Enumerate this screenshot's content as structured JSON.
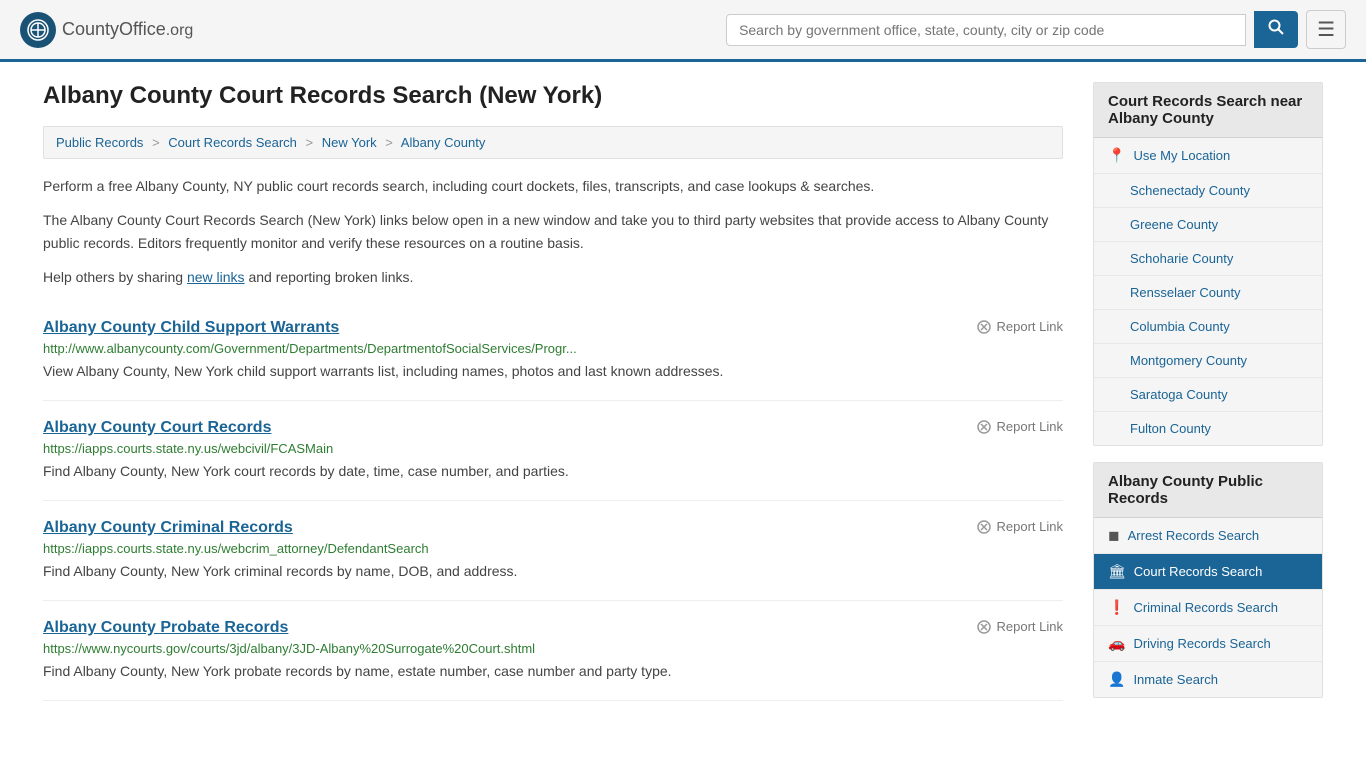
{
  "header": {
    "logo_text": "CountyOffice",
    "logo_suffix": ".org",
    "search_placeholder": "Search by government office, state, county, city or zip code"
  },
  "page": {
    "title": "Albany County Court Records Search (New York)",
    "breadcrumb": [
      {
        "label": "Public Records",
        "href": "#"
      },
      {
        "label": "Court Records Search",
        "href": "#"
      },
      {
        "label": "New York",
        "href": "#"
      },
      {
        "label": "Albany County",
        "href": "#"
      }
    ],
    "desc1": "Perform a free Albany County, NY public court records search, including court dockets, files, transcripts, and case lookups & searches.",
    "desc2": "The Albany County Court Records Search (New York) links below open in a new window and take you to third party websites that provide access to Albany County public records. Editors frequently monitor and verify these resources on a routine basis.",
    "desc3_pre": "Help others by sharing ",
    "desc3_link": "new links",
    "desc3_post": " and reporting broken links."
  },
  "results": [
    {
      "title": "Albany County Child Support Warrants",
      "url": "http://www.albanycounty.com/Government/Departments/DepartmentofSocialServices/Progr...",
      "desc": "View Albany County, New York child support warrants list, including names, photos and last known addresses.",
      "report": "Report Link"
    },
    {
      "title": "Albany County Court Records",
      "url": "https://iapps.courts.state.ny.us/webcivil/FCASMain",
      "desc": "Find Albany County, New York court records by date, time, case number, and parties.",
      "report": "Report Link"
    },
    {
      "title": "Albany County Criminal Records",
      "url": "https://iapps.courts.state.ny.us/webcrim_attorney/DefendantSearch",
      "desc": "Find Albany County, New York criminal records by name, DOB, and address.",
      "report": "Report Link"
    },
    {
      "title": "Albany County Probate Records",
      "url": "https://www.nycourts.gov/courts/3jd/albany/3JD-Albany%20Surrogate%20Court.shtml",
      "desc": "Find Albany County, New York probate records by name, estate number, case number and party type.",
      "report": "Report Link"
    }
  ],
  "sidebar": {
    "nearby_header": "Court Records Search near Albany County",
    "nearby_items": [
      {
        "label": "Use My Location",
        "icon": "loc"
      },
      {
        "label": "Schenectady County",
        "icon": "none"
      },
      {
        "label": "Greene County",
        "icon": "none"
      },
      {
        "label": "Schoharie County",
        "icon": "none"
      },
      {
        "label": "Rensselaer County",
        "icon": "none"
      },
      {
        "label": "Columbia County",
        "icon": "none"
      },
      {
        "label": "Montgomery County",
        "icon": "none"
      },
      {
        "label": "Saratoga County",
        "icon": "none"
      },
      {
        "label": "Fulton County",
        "icon": "none"
      }
    ],
    "records_header": "Albany County Public Records",
    "records_items": [
      {
        "label": "Arrest Records Search",
        "icon": "square",
        "active": false
      },
      {
        "label": "Court Records Search",
        "icon": "building",
        "active": true
      },
      {
        "label": "Criminal Records Search",
        "icon": "exclamation",
        "active": false
      },
      {
        "label": "Driving Records Search",
        "icon": "car",
        "active": false
      },
      {
        "label": "Inmate Search",
        "icon": "person",
        "active": false
      }
    ]
  }
}
